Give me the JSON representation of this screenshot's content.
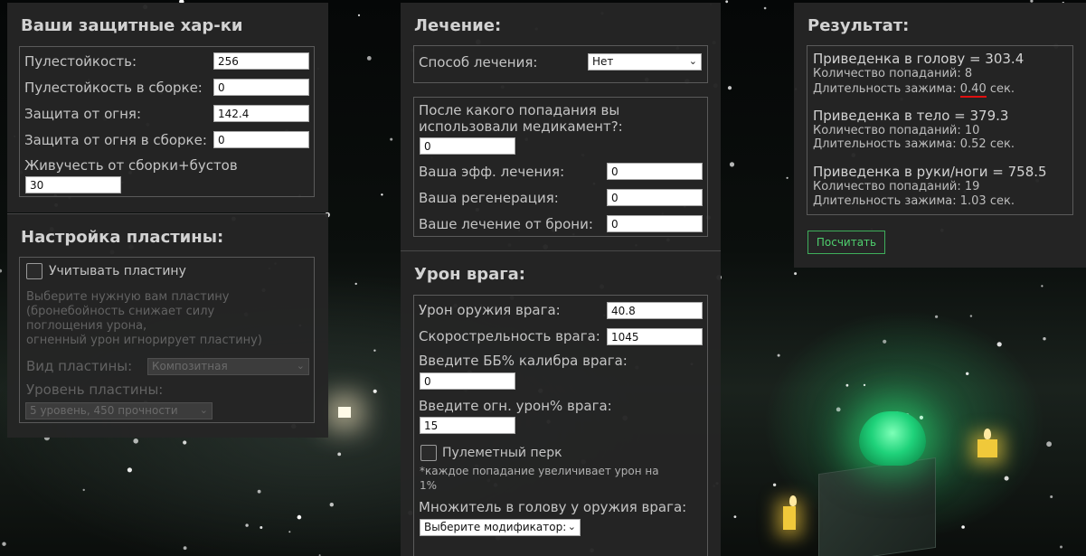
{
  "defense": {
    "title": "Ваши защитные хар-ки",
    "bullet_res_label": "Пулестойкость:",
    "bullet_res_value": "256",
    "bullet_res_build_label": "Пулестойкость в сборке:",
    "bullet_res_build_value": "0",
    "fire_prot_label": "Защита от огня:",
    "fire_prot_value": "142.4",
    "fire_prot_build_label": "Защита от огня в сборке:",
    "fire_prot_build_value": "0",
    "vitality_label": "Живучесть от сборки+бустов",
    "vitality_value": "30"
  },
  "plate": {
    "title": "Настройка пластины:",
    "use_plate_label": "Учитывать пластину",
    "hint_line1": "Выберите нужную вам пластину",
    "hint_line2": "(бронебойность снижает силу",
    "hint_line3": "поглощения урона,",
    "hint_line4": "огненный урон игнорирует пластину)",
    "type_label": "Вид пластины:",
    "type_value": "Композитная",
    "level_label": "Уровень пластины:",
    "level_value": "5 уровень, 450 прочности"
  },
  "heal": {
    "title": "Лечение:",
    "method_label": "Способ лечения:",
    "method_value": "Нет",
    "after_hit_line1": "После какого попадания вы",
    "after_hit_line2": "использовали медикамент?:",
    "after_hit_value": "0",
    "eff_label": "Ваша эфф. лечения:",
    "eff_value": "0",
    "regen_label": "Ваша регенерация:",
    "regen_value": "0",
    "armor_heal_label": "Ваше лечение от брони:",
    "armor_heal_value": "0"
  },
  "enemy": {
    "title": "Урон врага:",
    "weapon_dmg_label": "Урон оружия врага:",
    "weapon_dmg_value": "40.8",
    "fire_rate_label": "Скорострельность врага:",
    "fire_rate_value": "1045",
    "ap_label": "Введите ББ% калибра врага:",
    "ap_value": "0",
    "fire_dmg_label": "Введите огн. урон% врага:",
    "fire_dmg_value": "15",
    "mg_perk_label": "Пулеметный перк",
    "mg_perk_note_line1": "*каждое попадание увеличивает урон на",
    "mg_perk_note_line2": "1%",
    "head_mult_label": "Множитель в голову у оружия врага:",
    "head_mult_value": "Выберите модификатор:"
  },
  "result": {
    "title": "Результат:",
    "head_title": "Приведенка в голову = 303.4",
    "head_hits": "Количество попаданий: 8",
    "head_dur_prefix": "Длительность зажима:",
    "head_dur_value": "0.40",
    "head_dur_unit": "сек.",
    "body_title": "Приведенка в тело = 379.3",
    "body_hits": "Количество попаданий: 10",
    "body_dur": "Длительность зажима: 0.52 сек.",
    "limbs_title": "Приведенка в руки/ноги = 758.5",
    "limbs_hits": "Количество попаданий: 19",
    "limbs_dur": "Длительность зажима: 1.03 сек.",
    "calc_button": "Посчитать"
  },
  "colors": {
    "panel_bg": "#252525",
    "accent_green": "#4fd06e",
    "underline_red": "#e01010",
    "glow_green": "#1fd27a"
  }
}
